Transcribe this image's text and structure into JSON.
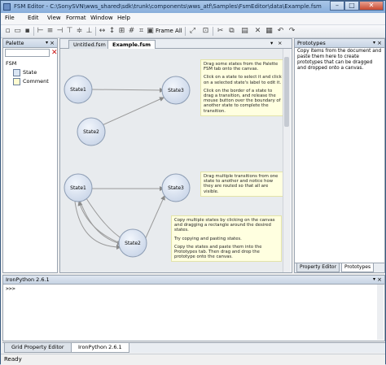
{
  "window": {
    "title": "FSM Editor - C:\\SonySVN\\wws_shared\\sdk\\trunk\\components\\wws_atf\\Samples\\FsmEditor\\data\\Example.fsm"
  },
  "menu": [
    "File",
    "Edit",
    "View",
    "Format",
    "Window",
    "Help"
  ],
  "toolbar": {
    "frame_all": "Frame All"
  },
  "palette": {
    "title": "Palette",
    "search_placeholder": "",
    "root": "FSM",
    "items": [
      "State",
      "Comment"
    ]
  },
  "document": {
    "tabs": [
      "Untitled.fsm",
      "Example.fsm"
    ],
    "active_tab": "Example.fsm",
    "states": [
      "State1",
      "State2",
      "State3",
      "State1",
      "State3",
      "State2"
    ],
    "notes": {
      "top": [
        "Drag some states from the Palette FSM tab onto the canvas.",
        "Click on a state to select it and click on a selected state's label to edit it.",
        "Click on the border of a state to drag a transition, and release the mouse button over the boundary of another state to complete the transition."
      ],
      "middle": [
        "Drag multiple transitions from one state to another and notice how they are routed so that all are visible."
      ],
      "bottom": [
        "Copy multiple states by clicking on the canvas and dragging a rectangle around the desired states.",
        "Try copying and pasting states.",
        "Copy the states and paste them into the Prototypes tab. Then drag and drop the prototype onto the canvas."
      ]
    }
  },
  "prototypes": {
    "title": "Prototypes",
    "description": "Copy items from the document and paste them here to create prototypes that can be dragged and dropped onto a canvas.",
    "tabs": [
      "Property Editor",
      "Prototypes"
    ],
    "active_tab": "Prototypes"
  },
  "console": {
    "title": "IronPython 2.6.1",
    "prompt": ">>>",
    "tabs": [
      "Grid Property Editor",
      "IronPython 2.6.1"
    ],
    "active_tab": "IronPython 2.6.1"
  },
  "status": {
    "text": "Ready"
  },
  "colors": {
    "state_fill": "#d4deee",
    "state_stroke": "#8c9cb3",
    "note_fill": "#ffffe0",
    "transition": "#9a9a9a"
  }
}
